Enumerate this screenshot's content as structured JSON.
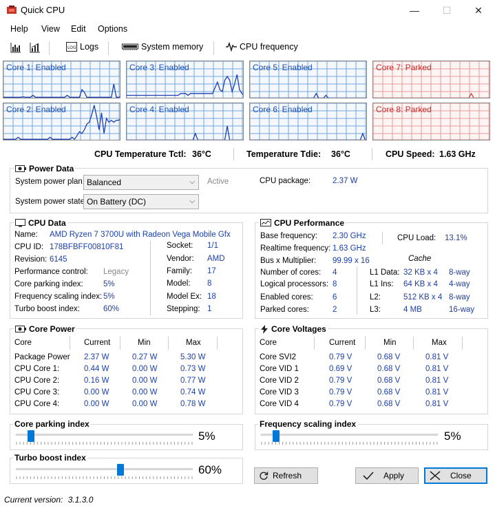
{
  "window": {
    "title": "Quick CPU",
    "minimize": "—",
    "maximize": "☐",
    "close": "✕"
  },
  "menu": [
    "Help",
    "View",
    "Edit",
    "Options"
  ],
  "toolbar": {
    "logs": "Logs",
    "system_memory": "System memory",
    "cpu_frequency": "CPU frequency"
  },
  "cores": [
    {
      "label": "Core 1: Enabled",
      "state": "enabled",
      "trace": [
        0.95,
        0.95,
        0.95,
        0.95,
        0.95,
        0.95,
        0.95,
        0.95,
        0.94,
        0.95,
        0.95,
        0.95,
        0.9,
        0.95,
        0.95,
        0.95,
        0.95,
        0.95,
        0.95,
        0.95,
        0.95,
        0.95,
        0.95,
        0.95,
        0.95,
        0.95,
        0.9,
        0.95,
        0.95,
        0.95,
        0.95,
        0.95,
        0.75,
        0.82,
        0.95,
        0.95,
        0.95,
        0.95,
        0.95,
        0.95,
        0.95,
        0.95,
        0.95,
        0.95,
        0.95,
        0.6,
        0.95,
        0.95,
        0.92
      ]
    },
    {
      "label": "Core 3: Enabled",
      "state": "enabled",
      "trace": [
        0.9,
        0.9,
        0.9,
        0.9,
        0.9,
        0.9,
        0.9,
        0.9,
        0.9,
        0.9,
        0.9,
        0.9,
        0.9,
        0.9,
        0.9,
        0.9,
        0.9,
        0.9,
        0.9,
        0.9,
        0.9,
        0.9,
        0.85,
        0.85,
        0.85,
        0.9,
        0.85,
        0.85,
        0.85,
        0.85,
        0.85,
        0.85,
        0.85,
        0.85,
        0.85,
        0.85,
        0.7,
        0.55,
        0.75,
        0.8,
        0.5,
        0.4,
        0.5,
        0.8,
        0.6,
        0.35,
        0.75,
        0.85,
        0.9
      ]
    },
    {
      "label": "Core 5: Enabled",
      "state": "enabled",
      "trace": [
        0.97,
        0.97,
        0.97,
        0.97,
        0.97,
        0.97,
        0.97,
        0.97,
        0.97,
        0.97,
        0.97,
        0.97,
        0.97,
        0.97,
        0.97,
        0.97,
        0.97,
        0.97,
        0.97,
        0.97,
        0.97,
        0.97,
        0.97,
        0.97,
        0.97,
        0.97,
        0.97,
        0.85,
        0.97,
        0.97,
        0.97,
        0.9,
        0.97,
        0.97,
        0.97,
        0.97,
        0.97,
        0.97,
        0.97,
        0.97,
        0.97,
        0.97,
        0.97,
        0.97,
        0.97,
        0.97,
        0.97,
        0.97,
        0.97
      ]
    },
    {
      "label": "Core 7: Parked",
      "state": "parked",
      "trace": [
        0.97,
        0.97,
        0.97,
        0.97,
        0.97,
        0.97,
        0.97,
        0.97,
        0.97,
        0.97,
        0.97,
        0.97,
        0.97,
        0.97,
        0.97,
        0.97,
        0.97,
        0.97,
        0.97,
        0.97,
        0.97,
        0.97,
        0.97,
        0.97,
        0.97,
        0.97,
        0.97,
        0.97,
        0.97,
        0.97,
        0.97,
        0.97,
        0.97,
        0.97,
        0.97,
        0.97,
        0.97,
        0.97,
        0.97,
        0.97,
        0.85,
        0.97,
        0.97,
        0.97,
        0.97,
        0.97,
        0.97,
        0.97,
        0.97
      ]
    },
    {
      "label": "Core 2: Enabled",
      "state": "enabled",
      "trace": [
        0.95,
        0.95,
        0.95,
        0.95,
        0.95,
        0.95,
        0.9,
        0.95,
        0.95,
        0.95,
        0.95,
        0.95,
        0.95,
        0.95,
        0.95,
        0.95,
        0.95,
        0.95,
        0.95,
        0.9,
        0.95,
        0.95,
        0.95,
        0.95,
        0.95,
        0.95,
        0.95,
        0.95,
        0.9,
        0.95,
        0.85,
        0.75,
        0.8,
        0.7,
        0.55,
        0.5,
        0.3,
        0.05,
        0.35,
        0.7,
        0.25,
        0.8,
        0.4,
        0.5,
        0.45,
        0.5,
        0.45,
        0.45,
        0.4
      ]
    },
    {
      "label": "Core 4: Enabled",
      "state": "enabled",
      "trace": [
        0.97,
        0.97,
        0.97,
        0.97,
        0.97,
        0.97,
        0.97,
        0.97,
        0.97,
        0.97,
        0.97,
        0.97,
        0.97,
        0.97,
        0.97,
        0.97,
        0.97,
        0.97,
        0.97,
        0.97,
        0.97,
        0.97,
        0.97,
        0.97,
        0.97,
        0.97,
        0.97,
        0.97,
        0.8,
        0.97,
        0.97,
        0.97,
        0.97,
        0.97,
        0.97,
        0.97,
        0.97,
        0.97,
        0.97,
        0.97,
        0.97,
        0.6,
        0.97,
        0.97,
        0.97,
        0.97,
        0.97,
        0.97,
        0.97
      ]
    },
    {
      "label": "Core 6: Enabled",
      "state": "enabled",
      "trace": [
        0.97,
        0.97,
        0.97,
        0.97,
        0.97,
        0.97,
        0.97,
        0.97,
        0.97,
        0.97,
        0.97,
        0.97,
        0.97,
        0.97,
        0.97,
        0.97,
        0.97,
        0.97,
        0.97,
        0.97,
        0.97,
        0.97,
        0.97,
        0.97,
        0.97,
        0.97,
        0.97,
        0.97,
        0.97,
        0.97,
        0.97,
        0.97,
        0.97,
        0.97,
        0.97,
        0.97,
        0.97,
        0.97,
        0.97,
        0.97,
        0.97,
        0.97,
        0.97,
        0.97,
        0.97,
        0.97,
        0.8,
        0.97,
        0.97
      ]
    },
    {
      "label": "Core 8: Parked",
      "state": "parked",
      "trace": [
        0.97,
        0.97,
        0.97,
        0.97,
        0.97,
        0.97,
        0.97,
        0.97,
        0.97,
        0.97,
        0.97,
        0.97,
        0.97,
        0.97,
        0.97,
        0.97,
        0.97,
        0.97,
        0.97,
        0.97,
        0.97,
        0.97,
        0.97,
        0.97,
        0.97,
        0.97,
        0.97,
        0.97,
        0.97,
        0.97,
        0.97,
        0.97,
        0.97,
        0.97,
        0.97,
        0.97,
        0.97,
        0.97,
        0.97,
        0.97,
        0.97,
        0.97,
        0.97,
        0.97,
        0.97,
        0.97,
        0.97,
        0.97,
        0.97
      ]
    }
  ],
  "temps": {
    "tctl_label": "CPU Temperature Tctl:",
    "tctl_value": "36°C",
    "tdie_label": "Temperature Tdie:",
    "tdie_value": "36°C",
    "speed_label": "CPU Speed:",
    "speed_value": "1.63 GHz"
  },
  "power_data": {
    "title": "Power Data",
    "plan_label": "System power plan:",
    "plan_value": "Balanced",
    "plan_status": "Active",
    "state_label": "System power state:",
    "state_value": "On Battery (DC)",
    "package_label": "CPU package:",
    "package_value": "2.37 W"
  },
  "cpu_data": {
    "title": "CPU Data",
    "name_label": "Name:",
    "name_value": "AMD Ryzen 7 3700U with Radeon Vega Mobile Gfx",
    "id_label": "CPU ID:",
    "id_value": "178BFBFF00810F81",
    "revision_label": "Revision:",
    "revision_value": "6145",
    "perfctl_label": "Performance control:",
    "perfctl_value": "Legacy",
    "parking_label": "Core parking index:",
    "parking_value": "5%",
    "freqscale_label": "Frequency scaling index:",
    "freqscale_value": "5%",
    "turbo_label": "Turbo boost index:",
    "turbo_value": "60%",
    "socket_label": "Socket:",
    "socket_value": "1/1",
    "vendor_label": "Vendor:",
    "vendor_value": "AMD",
    "family_label": "Family:",
    "family_value": "17",
    "model_label": "Model:",
    "model_value": "8",
    "modelex_label": "Model Ex:",
    "modelex_value": "18",
    "stepping_label": "Stepping:",
    "stepping_value": "1"
  },
  "cpu_perf": {
    "title": "CPU Performance",
    "base_label": "Base frequency:",
    "base_value": "2.30 GHz",
    "realtime_label": "Realtime frequency:",
    "realtime_value": "1.63 GHz",
    "busmult_label": "Bus x Multiplier:",
    "busmult_value": "99.99 x 16",
    "cores_label": "Number of cores:",
    "cores_value": "4",
    "logical_label": "Logical processors:",
    "logical_value": "8",
    "enabled_label": "Enabled cores:",
    "enabled_value": "6",
    "parked_label": "Parked cores:",
    "parked_value": "2",
    "load_label": "CPU Load:",
    "load_value": "13.1%",
    "cache_title": "Cache",
    "cache": [
      {
        "label": "L1 Data:",
        "size": "32 KB x 4",
        "way": "8-way"
      },
      {
        "label": "L1 Ins:",
        "size": "64 KB x 4",
        "way": "4-way"
      },
      {
        "label": "L2:",
        "size": "512 KB x 4",
        "way": "8-way"
      },
      {
        "label": "L3:",
        "size": "4 MB",
        "way": "16-way"
      }
    ]
  },
  "core_power": {
    "title": "Core Power",
    "headers": [
      "Core",
      "Current",
      "Min",
      "Max"
    ],
    "rows": [
      [
        "Package Power",
        "2.37 W",
        "0.27 W",
        "5.30 W"
      ],
      [
        "CPU Core 1:",
        "0.44 W",
        "0.00 W",
        "0.73 W"
      ],
      [
        "CPU Core 2:",
        "0.16 W",
        "0.00 W",
        "0.77 W"
      ],
      [
        "CPU Core 3:",
        "0.00 W",
        "0.00 W",
        "0.74 W"
      ],
      [
        "CPU Core 4:",
        "0.00 W",
        "0.00 W",
        "0.78 W"
      ]
    ]
  },
  "core_voltages": {
    "title": "Core Voltages",
    "headers": [
      "Core",
      "Current",
      "Min",
      "Max"
    ],
    "rows": [
      [
        "Core SVI2",
        "0.79 V",
        "0.68 V",
        "0.81 V"
      ],
      [
        "Core VID 1",
        "0.69 V",
        "0.68 V",
        "0.81 V"
      ],
      [
        "Core VID 2",
        "0.79 V",
        "0.68 V",
        "0.81 V"
      ],
      [
        "Core VID 3",
        "0.79 V",
        "0.68 V",
        "0.81 V"
      ],
      [
        "Core VID 4",
        "0.79 V",
        "0.68 V",
        "0.81 V"
      ]
    ]
  },
  "sliders": {
    "parking": {
      "title": "Core parking index",
      "value": 5,
      "display": "5%"
    },
    "freqscale": {
      "title": "Frequency scaling index",
      "value": 5,
      "display": "5%"
    },
    "turbo": {
      "title": "Turbo boost index",
      "value": 60,
      "display": "60%"
    }
  },
  "buttons": {
    "refresh": "Refresh",
    "apply": "Apply",
    "close": "Close"
  },
  "status": {
    "version_label": "Current version:",
    "version_value": "3.1.3.0"
  },
  "colors": {
    "enabled_grid": "#6fa8dc",
    "enabled_line": "#1f3fb0",
    "parked_grid": "#e89a9a",
    "parked_line": "#d04040",
    "accent": "#0078d7"
  }
}
